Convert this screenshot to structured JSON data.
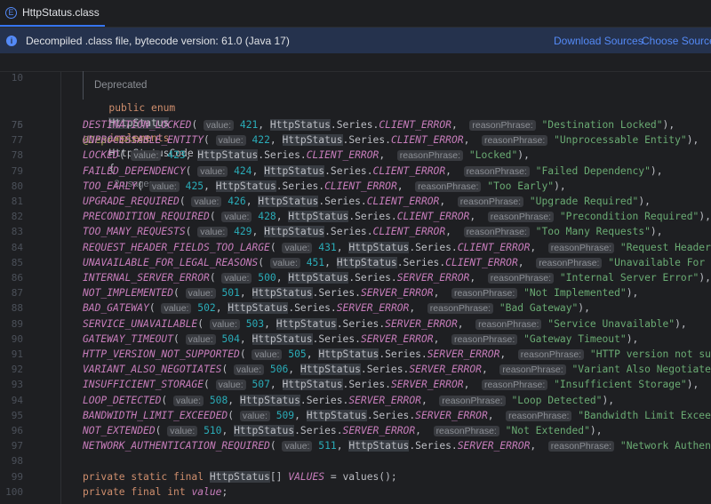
{
  "tab": {
    "icon": "E",
    "label": "HttpStatus.class"
  },
  "infobar": {
    "icon": "i",
    "message": "Decompiled .class file, bytecode version: 61.0 (Java 17)",
    "download_sources": "Download Sources",
    "choose_sources": "Choose Sources..."
  },
  "header": {
    "line": "10",
    "kw1": "public enum",
    "name": "HttpStatus",
    "kw2": "implements",
    "iface": "HttpStatusCode",
    "brace": "{",
    "usages": "2 usages"
  },
  "deprecated_doc": "Deprecated",
  "annotation_line": {
    "num": "75",
    "text": "@Deprecated"
  },
  "enum_entries": [
    {
      "num": "76",
      "name": "DESTINATION_LOCKED",
      "value": "421",
      "series": "CLIENT_ERROR",
      "phrase": "\"Destination Locked\"",
      "end": "),"
    },
    {
      "num": "77",
      "name": "UNPROCESSABLE_ENTITY",
      "value": "422",
      "series": "CLIENT_ERROR",
      "phrase": "\"Unprocessable Entity\"",
      "end": "),"
    },
    {
      "num": "78",
      "name": "LOCKED",
      "value": "423",
      "series": "CLIENT_ERROR",
      "phrase": "\"Locked\"",
      "end": "),"
    },
    {
      "num": "79",
      "name": "FAILED_DEPENDENCY",
      "value": "424",
      "series": "CLIENT_ERROR",
      "phrase": "\"Failed Dependency\"",
      "end": "),"
    },
    {
      "num": "80",
      "name": "TOO_EARLY",
      "value": "425",
      "series": "CLIENT_ERROR",
      "phrase": "\"Too Early\"",
      "end": "),"
    },
    {
      "num": "81",
      "name": "UPGRADE_REQUIRED",
      "value": "426",
      "series": "CLIENT_ERROR",
      "phrase": "\"Upgrade Required\"",
      "end": "),"
    },
    {
      "num": "82",
      "name": "PRECONDITION_REQUIRED",
      "value": "428",
      "series": "CLIENT_ERROR",
      "phrase": "\"Precondition Required\"",
      "end": "),"
    },
    {
      "num": "83",
      "name": "TOO_MANY_REQUESTS",
      "value": "429",
      "series": "CLIENT_ERROR",
      "phrase": "\"Too Many Requests\"",
      "end": "),"
    },
    {
      "num": "84",
      "name": "REQUEST_HEADER_FIELDS_TOO_LARGE",
      "value": "431",
      "series": "CLIENT_ERROR",
      "phrase": "\"Request Header Fields Too",
      "end": ""
    },
    {
      "num": "85",
      "name": "UNAVAILABLE_FOR_LEGAL_REASONS",
      "value": "451",
      "series": "CLIENT_ERROR",
      "phrase": "\"Unavailable For Legal Reason",
      "end": ""
    },
    {
      "num": "86",
      "name": "INTERNAL_SERVER_ERROR",
      "value": "500",
      "series": "SERVER_ERROR",
      "phrase": "\"Internal Server Error\"",
      "end": "),"
    },
    {
      "num": "87",
      "name": "NOT_IMPLEMENTED",
      "value": "501",
      "series": "SERVER_ERROR",
      "phrase": "\"Not Implemented\"",
      "end": "),"
    },
    {
      "num": "88",
      "name": "BAD_GATEWAY",
      "value": "502",
      "series": "SERVER_ERROR",
      "phrase": "\"Bad Gateway\"",
      "end": "),"
    },
    {
      "num": "89",
      "name": "SERVICE_UNAVAILABLE",
      "value": "503",
      "series": "SERVER_ERROR",
      "phrase": "\"Service Unavailable\"",
      "end": "),"
    },
    {
      "num": "90",
      "name": "GATEWAY_TIMEOUT",
      "value": "504",
      "series": "SERVER_ERROR",
      "phrase": "\"Gateway Timeout\"",
      "end": "),"
    },
    {
      "num": "91",
      "name": "HTTP_VERSION_NOT_SUPPORTED",
      "value": "505",
      "series": "SERVER_ERROR",
      "phrase": "\"HTTP version not supported\"",
      "end": "),"
    },
    {
      "num": "92",
      "name": "VARIANT_ALSO_NEGOTIATES",
      "value": "506",
      "series": "SERVER_ERROR",
      "phrase": "\"Variant Also Negotiates\"",
      "end": "),"
    },
    {
      "num": "93",
      "name": "INSUFFICIENT_STORAGE",
      "value": "507",
      "series": "SERVER_ERROR",
      "phrase": "\"Insufficient Storage\"",
      "end": "),"
    },
    {
      "num": "94",
      "name": "LOOP_DETECTED",
      "value": "508",
      "series": "SERVER_ERROR",
      "phrase": "\"Loop Detected\"",
      "end": "),"
    },
    {
      "num": "95",
      "name": "BANDWIDTH_LIMIT_EXCEEDED",
      "value": "509",
      "series": "SERVER_ERROR",
      "phrase": "\"Bandwidth Limit Exceeded\"",
      "end": "),"
    },
    {
      "num": "96",
      "name": "NOT_EXTENDED",
      "value": "510",
      "series": "SERVER_ERROR",
      "phrase": "\"Not Extended\"",
      "end": "),"
    },
    {
      "num": "97",
      "name": "NETWORK_AUTHENTICATION_REQUIRED",
      "value": "511",
      "series": "SERVER_ERROR",
      "phrase": "\"Network Authentication Rec",
      "end": ""
    }
  ],
  "inlay": {
    "value": "value:",
    "reason": "reasonPhrase:",
    "series_class": "HttpStatus.Series."
  },
  "enum_ref": "HttpStatus",
  "tail_lines": [
    {
      "num": "98",
      "kw": "",
      "type": "",
      "rest": "",
      "field": "",
      "end": ""
    },
    {
      "num": "99",
      "kw": "private static final",
      "type": "HttpStatus",
      "rest": "[]",
      "field": "VALUES",
      "end": " = values();"
    },
    {
      "num": "100",
      "kw": "private final int",
      "type": "",
      "rest": "",
      "field": "value",
      "end": ";"
    }
  ],
  "colors": {
    "accent": "#3574f0",
    "info_bg": "#25324d",
    "link": "#548af7",
    "editor_bg": "#1e1f22"
  }
}
